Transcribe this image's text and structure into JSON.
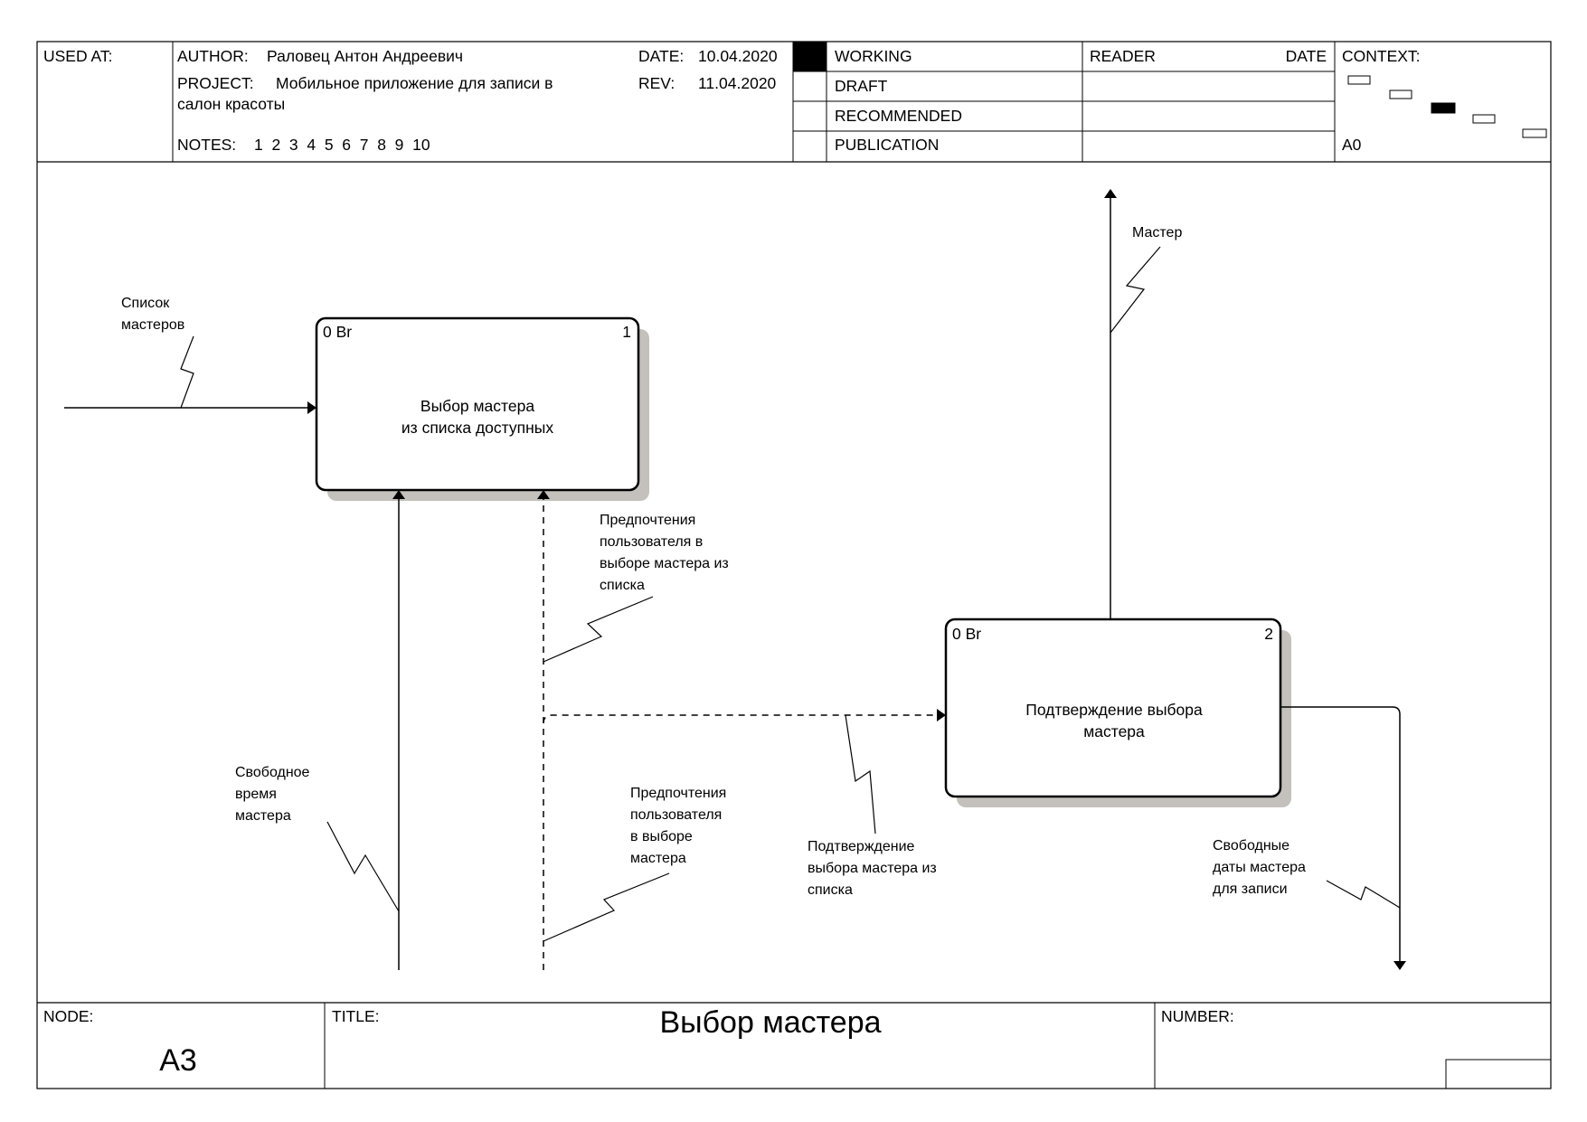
{
  "header": {
    "used_at_label": "USED AT:",
    "author_label": "AUTHOR:",
    "author": "Раловец Антон Андреевич",
    "project_label": "PROJECT:",
    "project_line1": "Мобильное приложение для записи в",
    "project_line2": "салон красоты",
    "notes_label": "NOTES:",
    "notes": "1  2  3  4  5  6  7  8  9  10",
    "date_label": "DATE:",
    "date": "10.04.2020",
    "rev_label": "REV:",
    "rev": "11.04.2020",
    "statuses": [
      "WORKING",
      "DRAFT",
      "RECOMMENDED",
      "PUBLICATION"
    ],
    "active_status": "WORKING",
    "reader_label": "READER",
    "reader_date_label": "DATE",
    "context_label": "CONTEXT:",
    "context_node": "A0"
  },
  "diagram": {
    "boxes": [
      {
        "id": "box-1",
        "corner": "0 Br",
        "number": "1",
        "line1": "Выбор мастера",
        "line2": "из списка доступных"
      },
      {
        "id": "box-2",
        "corner": "0 Br",
        "number": "2",
        "line1": "Подтверждение выбора",
        "line2": "мастера"
      }
    ],
    "arrows": [
      {
        "id": "spisok",
        "lines": [
          "Список",
          "мастеров"
        ]
      },
      {
        "id": "master",
        "lines": [
          "Мастер"
        ]
      },
      {
        "id": "svobodnoe",
        "lines": [
          "Свободное",
          "время",
          "мастера"
        ]
      },
      {
        "id": "pref1",
        "lines": [
          "Предпочтения",
          "пользователя в",
          "выборе мастера из",
          "списка"
        ]
      },
      {
        "id": "pref2",
        "lines": [
          "Предпочтения",
          "пользователя",
          "в выборе",
          "мастера"
        ]
      },
      {
        "id": "confirm",
        "lines": [
          "Подтверждение",
          "выбора мастера из",
          "списка"
        ]
      },
      {
        "id": "free-dates",
        "lines": [
          "Свободные",
          "даты мастера",
          "для записи"
        ]
      }
    ]
  },
  "footer": {
    "node_label": "NODE:",
    "node": "A3",
    "title_label": "TITLE:",
    "title": "Выбор мастера",
    "number_label": "NUMBER:"
  }
}
